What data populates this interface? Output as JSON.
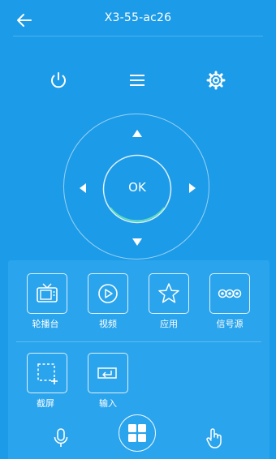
{
  "header": {
    "title": "X3-55-ac26",
    "back_icon": "arrow-left-icon"
  },
  "controls": {
    "power_icon": "power-icon",
    "menu_icon": "menu-icon",
    "settings_icon": "gear-icon"
  },
  "dpad": {
    "ok_label": "OK",
    "ok_ring_accent": "#5ee0b6"
  },
  "shortcuts": [
    {
      "label": "轮播台",
      "icon": "tv-icon"
    },
    {
      "label": "视频",
      "icon": "play-icon"
    },
    {
      "label": "应用",
      "icon": "star-icon"
    },
    {
      "label": "信号源",
      "icon": "signal-source-icon"
    },
    {
      "label": "截屏",
      "icon": "screenshot-icon"
    },
    {
      "label": "输入",
      "icon": "enter-icon"
    }
  ],
  "bottom_bar": {
    "mic_icon": "microphone-icon",
    "apps_icon": "apps-grid-icon",
    "touch_icon": "touch-hand-icon"
  },
  "colors": {
    "background": "#1c9be8",
    "panel": "#2aa4ec"
  }
}
